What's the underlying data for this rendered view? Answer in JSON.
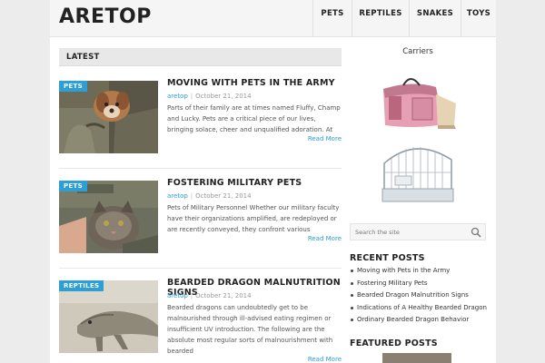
{
  "site": {
    "logo": "ARETOP"
  },
  "nav": {
    "items": [
      "PETS",
      "REPTILES",
      "SNAKES",
      "TOYS"
    ]
  },
  "main": {
    "section_heading": "LATEST",
    "posts": [
      {
        "category": "PETS",
        "title": "MOVING WITH PETS IN THE ARMY",
        "author": "aretop",
        "separator": "|",
        "date": "October 21, 2014",
        "excerpt": "Parts of their family are at times named Fluffy, Champ and Lucky. Pets are a critical piece of our lives, bringing solace, cheer and unqualified adoration. At the",
        "read_more": "Read More"
      },
      {
        "category": "PETS",
        "title": "FOSTERING MILITARY PETS",
        "author": "aretop",
        "separator": "|",
        "date": "October 21, 2014",
        "excerpt": "Pets of Military Personnel Whether our military faculty have their organizations amplified, are redeployed or are recently conveyed, they confront various troublesome choices in regards to home and",
        "read_more": "Read More"
      },
      {
        "category": "REPTILES",
        "title": "BEARDED DRAGON MALNUTRITION SIGNS",
        "author": "aretop",
        "separator": "|",
        "date": "October 21, 2014",
        "excerpt": "Bearded dragons can undoubtedly get to be malnourished through ill-advised eating regimen or insufficient UV introduction. The following are the absolute most regular sorts of malnourishment with bearded",
        "read_more": "Read More"
      }
    ]
  },
  "sidebar": {
    "ad_title": "Carriers",
    "search": {
      "placeholder": "Search the site"
    },
    "recent_title": "RECENT POSTS",
    "recent_posts": [
      "Moving with Pets in the Army",
      "Fostering Military Pets",
      "Bearded Dragon Malnutrition Signs",
      "Indications of A Healthy Bearded Dragon",
      "Ordinary Bearded Dragon Behavior"
    ],
    "featured_title": "FEATURED POSTS"
  },
  "colors": {
    "accent": "#2a9fd8",
    "header_bg": "#f5f5f5",
    "page_bg": "#ececec"
  }
}
